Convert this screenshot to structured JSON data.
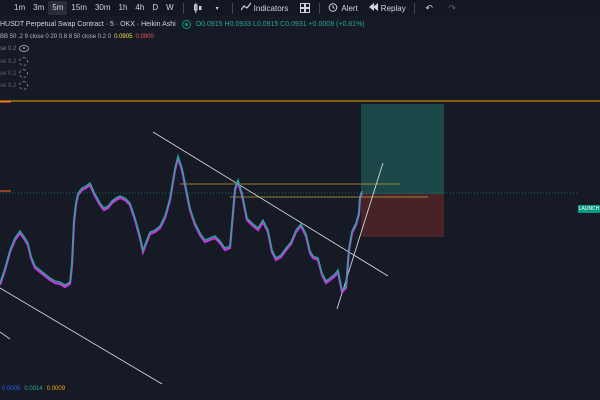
{
  "toolbar": {
    "timeframes": [
      "1m",
      "3m",
      "5m",
      "15m",
      "30m",
      "1h",
      "4h",
      "D",
      "W"
    ],
    "active_timeframe": "5m",
    "indicators_label": "Indicators",
    "alert_label": "Alert",
    "replay_label": "Replay"
  },
  "header": {
    "symbol_title": "HUSDT Perpetual Swap Contract · 5 · OKX · Heikin Ashi",
    "ohlc": "O0.0915 H0.0933 L0.0915 C0.0931 +0.0008 (+0.81%)"
  },
  "legend": {
    "bb_label": "BB 50 .2 9 close 0 20 0.8 8 50 close 0.2 0",
    "bb_value1": "0.0905",
    "bb_value2": "0.0900",
    "sub_rows": [
      "se 0.2",
      "se 0.2",
      "se 0.2",
      "se 0.2"
    ]
  },
  "bottom": {
    "v1": "0.0005",
    "v2": "0.0014",
    "v3": "0.0009"
  },
  "price_tag": "LAUNCH",
  "colors": {
    "background": "#161a25",
    "up": "#26a69a",
    "down": "#e040fb",
    "orange": "#f7a600",
    "tp_zone": "#1b4a4b",
    "sl_zone": "#4a2428"
  }
}
